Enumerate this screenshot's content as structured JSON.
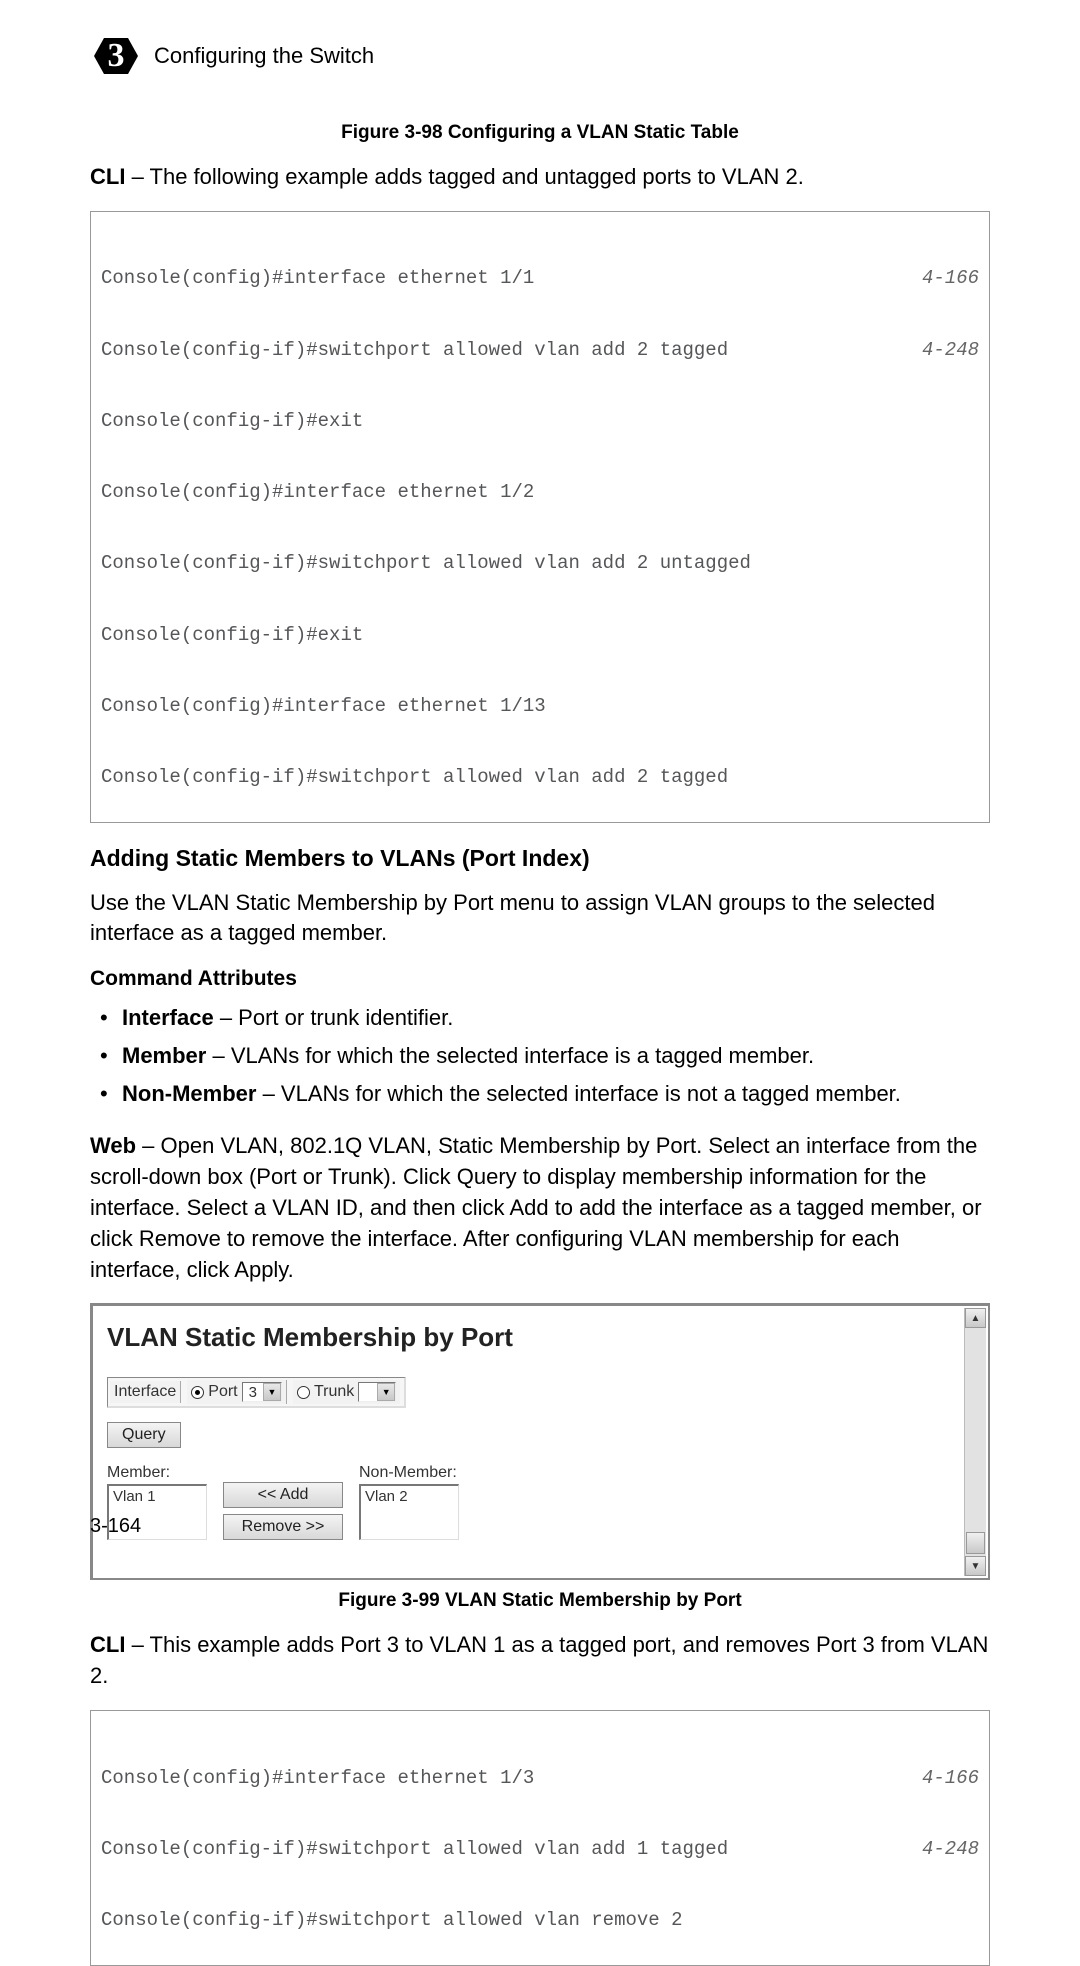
{
  "header": {
    "chapter_number": "3",
    "title": "Configuring the Switch"
  },
  "figure_98_caption": "Figure 3-98   Configuring a VLAN Static Table",
  "cli1_intro_bold": "CLI",
  "cli1_intro_rest": " – The following example adds tagged and untagged ports to VLAN 2.",
  "code1": {
    "lines": [
      {
        "text": "Console(config)#interface ethernet 1/1",
        "ref": "4-166"
      },
      {
        "text": "Console(config-if)#switchport allowed vlan add 2 tagged",
        "ref": "4-248"
      },
      {
        "text": "Console(config-if)#exit",
        "ref": ""
      },
      {
        "text": "Console(config)#interface ethernet 1/2",
        "ref": ""
      },
      {
        "text": "Console(config-if)#switchport allowed vlan add 2 untagged",
        "ref": ""
      },
      {
        "text": "Console(config-if)#exit",
        "ref": ""
      },
      {
        "text": "Console(config)#interface ethernet 1/13",
        "ref": ""
      },
      {
        "text": "Console(config-if)#switchport allowed vlan add 2 tagged",
        "ref": ""
      }
    ]
  },
  "section_heading_bold": "Adding Static Members to VLANs",
  "section_heading_rest": " (Port Index)",
  "section_para": "Use the VLAN Static Membership by Port menu to assign VLAN groups to the selected interface as a tagged member.",
  "cmd_attr_heading": "Command Attributes",
  "bullets": {
    "b1_bold": "Interface",
    "b1_rest": " – Port or trunk identifier.",
    "b2_bold": "Member",
    "b2_rest": " – VLANs for which the selected interface is a tagged member.",
    "b3_bold": "Non-Member",
    "b3_rest": " – VLANs for which the selected interface is not a tagged member."
  },
  "web_para_bold": "Web",
  "web_para_rest": " – Open VLAN, 802.1Q VLAN, Static Membership by Port. Select an interface from the scroll-down box (Port or Trunk). Click Query to display membership information for the interface. Select a VLAN ID, and then click Add to add the interface as a tagged member, or click Remove to remove the interface. After configuring VLAN membership for each interface, click Apply.",
  "ui": {
    "title": "VLAN Static Membership by Port",
    "interface_label": "Interface",
    "port_label": "Port",
    "port_value": "3",
    "trunk_label": "Trunk",
    "trunk_value": "",
    "query_label": "Query",
    "member_label": "Member:",
    "member_item": "Vlan 1",
    "nonmember_label": "Non-Member:",
    "nonmember_item": "Vlan 2",
    "add_label": "<< Add",
    "remove_label": "Remove >>"
  },
  "figure_99_caption": "Figure 3-99   VLAN Static Membership by Port",
  "cli2_intro_bold": "CLI",
  "cli2_intro_rest": " – This example adds Port 3 to VLAN 1 as a tagged port, and removes Port 3 from VLAN 2.",
  "code2": {
    "lines": [
      {
        "text": "Console(config)#interface ethernet 1/3",
        "ref": "4-166"
      },
      {
        "text": "Console(config-if)#switchport allowed vlan add 1 tagged",
        "ref": "4-248"
      },
      {
        "text": "Console(config-if)#switchport allowed vlan remove 2",
        "ref": ""
      }
    ]
  },
  "page_number": "3-164"
}
